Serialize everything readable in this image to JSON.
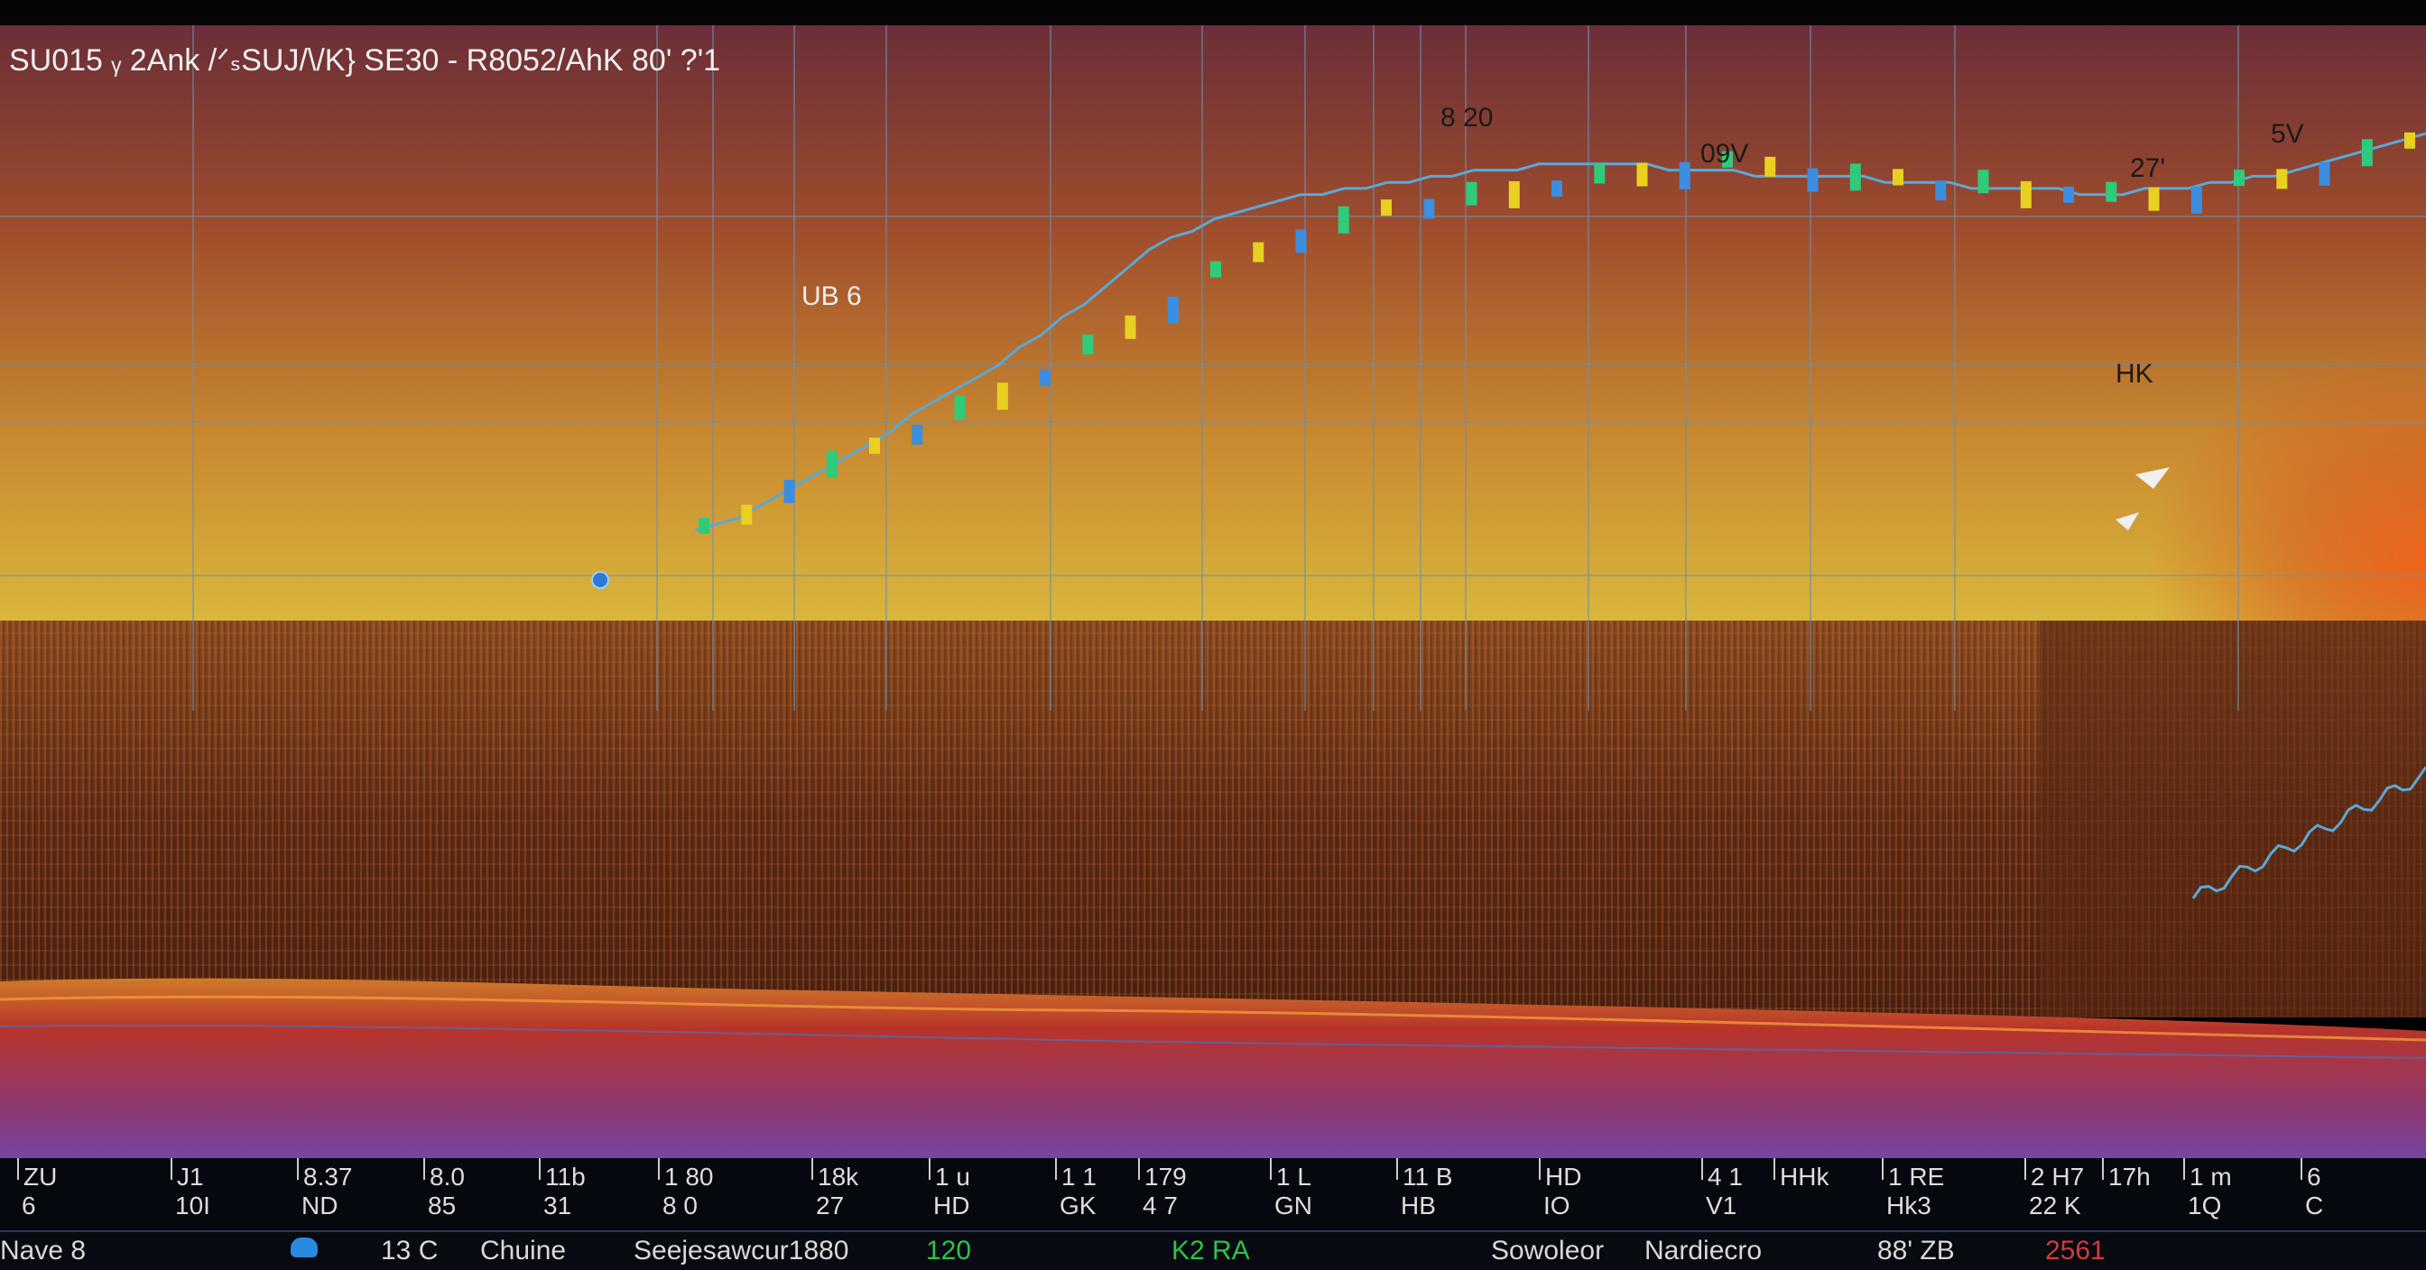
{
  "header": {
    "title": "SU015 ᵧ 2Ank /ᐟₛSUJ/\\/K} SE30 - R8052/AhK 80' ?'1"
  },
  "annotations": [
    {
      "key": "a1",
      "text": "8 20"
    },
    {
      "key": "a2",
      "text": "09V"
    },
    {
      "key": "a3",
      "text": "27'"
    },
    {
      "key": "a4",
      "text": "5V"
    },
    {
      "key": "a5",
      "text": "UB 6"
    },
    {
      "key": "a6",
      "text": "HK"
    }
  ],
  "x_ticks": [
    {
      "top": "ZU",
      "bottom": "6"
    },
    {
      "top": "J1",
      "bottom": "10I"
    },
    {
      "top": "8.37",
      "bottom": "ND"
    },
    {
      "top": "8.0",
      "bottom": "85"
    },
    {
      "top": "11b",
      "bottom": "31"
    },
    {
      "top": "1 80",
      "bottom": "8 0"
    },
    {
      "top": "18k",
      "bottom": "27"
    },
    {
      "top": "1 u",
      "bottom": "HD"
    },
    {
      "top": "1 1",
      "bottom": "GK"
    },
    {
      "top": "179",
      "bottom": "4 7"
    },
    {
      "top": "1 L",
      "bottom": "GN"
    },
    {
      "top": "11 B",
      "bottom": "HB"
    },
    {
      "top": "HD",
      "bottom": "IO"
    },
    {
      "top": "4 1",
      "bottom": "V1"
    },
    {
      "top": "HHk",
      "bottom": ""
    },
    {
      "top": "1 RE",
      "bottom": "Hk3"
    },
    {
      "top": "2 H7",
      "bottom": "22 K"
    },
    {
      "top": "17h",
      "bottom": ""
    },
    {
      "top": "1 m",
      "bottom": "1Q"
    },
    {
      "top": "6",
      "bottom": "C"
    }
  ],
  "footer": {
    "f1": "Nave 8",
    "f2": "13 C",
    "f3": "Chuine",
    "f4": "Seejesawcur1880",
    "f5": "120",
    "f6": "K2 RA",
    "f7": "Sowoleor",
    "f8": "Nardiecro",
    "f9": "88' ZB",
    "f10": "2561"
  },
  "colors": {
    "sky_top": "#70333a",
    "sky_mid": "#b6632a",
    "sky_low": "#d8b23a",
    "sun_glow": "#e0561a",
    "lower_band": "#7a3a1a",
    "red_band": "#b42a25",
    "purple_band": "#6a4bb8",
    "line": "#5aa8d8",
    "candle_green": "#2ecb7a",
    "candle_yellow": "#e8d020",
    "candle_blue": "#3b8ee0",
    "grid": "#6a8fb0",
    "footer_green": "#2ec24a",
    "footer_red": "#d23a3a"
  },
  "chart_data": {
    "type": "line",
    "title": "SU015 ᵧ 2Ank /ᐟₛSUJ/\\/K} SE30 - R8052/AhK 80' ?'1",
    "xlabel": "",
    "ylabel": "",
    "x": [
      0,
      1,
      2,
      3,
      4,
      5,
      6,
      7,
      8,
      9,
      10,
      11,
      12,
      13,
      14,
      15,
      16,
      17,
      18,
      19,
      20,
      21,
      22,
      23,
      24,
      25,
      26,
      27,
      28,
      29,
      30,
      31,
      32,
      33,
      34,
      35,
      36,
      37,
      38,
      39,
      40,
      41,
      42,
      43,
      44,
      45,
      46,
      47,
      48,
      49,
      50,
      51,
      52,
      53,
      54,
      55,
      56,
      57,
      58,
      59,
      60,
      61,
      62,
      63,
      64,
      65,
      66,
      67,
      68,
      69,
      70,
      71,
      72,
      73,
      74,
      75,
      76,
      77,
      78,
      79,
      80
    ],
    "series": [
      {
        "values": [
          26,
          27,
          28,
          30,
          32,
          34,
          36,
          38,
          40,
          42,
          45,
          47,
          49,
          51,
          53,
          56,
          58,
          61,
          63,
          66,
          69,
          72,
          74,
          75,
          77,
          78,
          79,
          80,
          81,
          81,
          82,
          82,
          83,
          83,
          84,
          84,
          85,
          85,
          85,
          86,
          86,
          86,
          86,
          86,
          86,
          85,
          85,
          85,
          85,
          84,
          84,
          84,
          84,
          84,
          84,
          83,
          83,
          83,
          83,
          82,
          82,
          82,
          82,
          82,
          81,
          81,
          81,
          82,
          82,
          82,
          83,
          83,
          84,
          84,
          85,
          86,
          87,
          88,
          89,
          90,
          91
        ]
      }
    ],
    "candles_y": [
      26,
      29,
      34,
      37,
      40,
      43,
      46,
      49,
      52,
      56,
      60,
      64,
      68,
      72,
      75,
      77,
      79,
      80,
      81,
      82,
      83,
      84,
      85,
      86,
      86,
      86,
      85,
      84,
      84,
      83,
      83,
      82,
      82,
      81,
      81,
      82,
      83,
      84,
      86,
      88,
      90
    ],
    "ylim": [
      0,
      100
    ],
    "xlim": [
      0,
      80
    ],
    "grid": true,
    "legend": "none"
  }
}
